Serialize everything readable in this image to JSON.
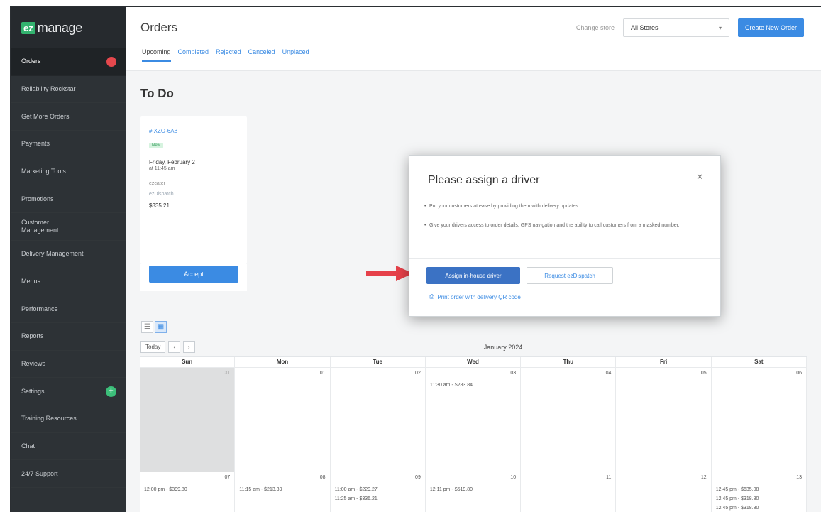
{
  "brand": {
    "badge": "ez",
    "name": "manage"
  },
  "sidebar": {
    "items": [
      {
        "label": "Orders",
        "active": true,
        "badge": "red-dot"
      },
      {
        "label": "Reliability Rockstar"
      },
      {
        "label": "Get More Orders"
      },
      {
        "label": "Payments"
      },
      {
        "label": "Marketing Tools"
      },
      {
        "label": "Promotions"
      },
      {
        "label": "Customer\nManagement"
      },
      {
        "label": "Delivery Management"
      },
      {
        "label": "Menus"
      },
      {
        "label": "Performance"
      },
      {
        "label": "Reports"
      },
      {
        "label": "Reviews"
      },
      {
        "label": "Settings",
        "badge_text": "+"
      },
      {
        "label": "Training Resources"
      },
      {
        "label": "Chat"
      },
      {
        "label": "24/7 Support"
      }
    ]
  },
  "header": {
    "title": "Orders",
    "store_label": "Change store",
    "store_value": "All Stores",
    "create_button": "Create New Order"
  },
  "tabs": [
    "Upcoming",
    "Completed",
    "Rejected",
    "Canceled",
    "Unplaced"
  ],
  "todo": {
    "title": "To Do",
    "order": {
      "id": "# XZO-6A8",
      "status": "New",
      "date": "Friday, February 2",
      "time": "at 11:45 am",
      "meta1": "ezcater",
      "meta2": "ezDispatch",
      "price": "$335.21"
    },
    "accept_button": "Accept"
  },
  "calendar": {
    "today_button": "Today",
    "prev": "‹",
    "next": "›",
    "month": "January 2024",
    "days": [
      "Sun",
      "Mon",
      "Tue",
      "Wed",
      "Thu",
      "Fri",
      "Sat"
    ],
    "week1": [
      {
        "day": "31",
        "muted": true,
        "events": []
      },
      {
        "day": "01",
        "events": []
      },
      {
        "day": "02",
        "events": []
      },
      {
        "day": "03",
        "events": [
          "11:30 am - $283.84"
        ]
      },
      {
        "day": "04",
        "events": []
      },
      {
        "day": "05",
        "events": []
      },
      {
        "day": "06",
        "events": []
      }
    ],
    "week2": [
      {
        "day": "07",
        "events": [
          "12:00 pm - $399.80"
        ]
      },
      {
        "day": "08",
        "events": [
          "11:15 am - $213.39"
        ]
      },
      {
        "day": "09",
        "events": [
          "11:00 am - $229.27",
          "11:25 am - $336.21"
        ]
      },
      {
        "day": "10",
        "events": [
          "12:11 pm - $519.80"
        ]
      },
      {
        "day": "11",
        "events": []
      },
      {
        "day": "12",
        "events": []
      },
      {
        "day": "13",
        "events": [
          "12:45 pm - $635.08",
          "12:45 pm - $318.80",
          "12:45 pm - $318.80"
        ]
      }
    ]
  },
  "modal": {
    "title": "Please assign a driver",
    "close": "×",
    "bullet1": "Put your customers at ease by providing them with delivery updates.",
    "bullet2": "Give your drivers access to order details, GPS navigation and the ability to call customers from a masked number.",
    "assign_button": "Assign in-house driver",
    "request_button": "Request ezDispatch",
    "print_link": "Print order with delivery QR code"
  },
  "colors": {
    "accent": "#3b8be3",
    "sidebar": "#2d3236",
    "arrow": "#e6414a"
  }
}
